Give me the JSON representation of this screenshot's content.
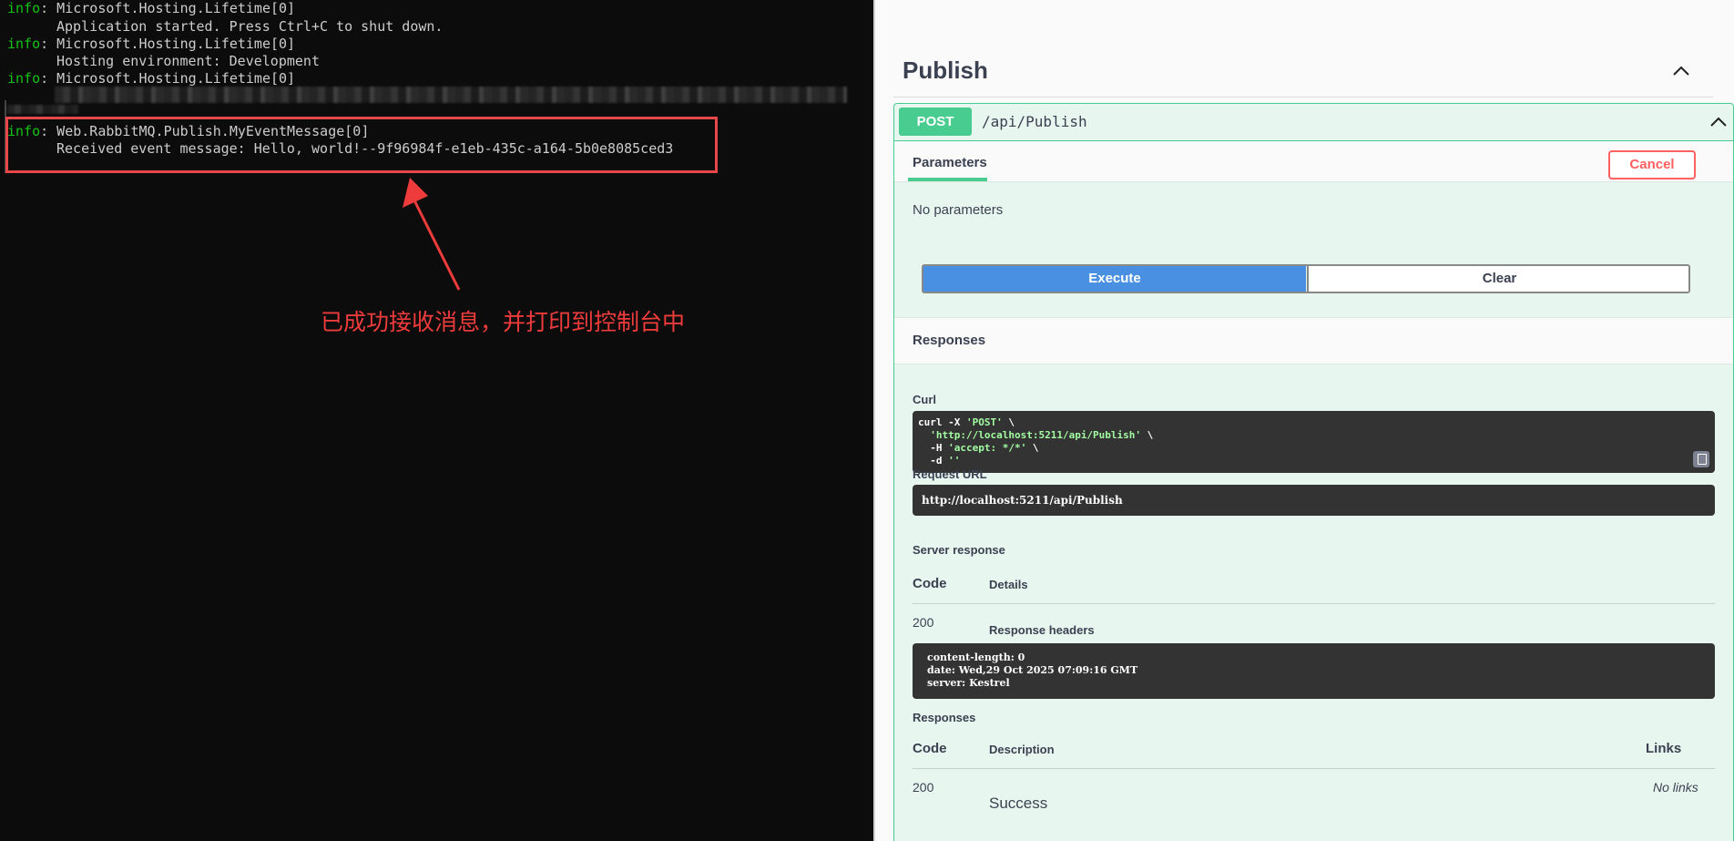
{
  "terminal": {
    "lines": [
      {
        "level": "info",
        "text": ": Microsoft.Hosting.Lifetime[0]"
      },
      {
        "text": "Application started. Press Ctrl+C to shut down."
      },
      {
        "level": "info",
        "text": ": Microsoft.Hosting.Lifetime[0]"
      },
      {
        "text": "Hosting environment: Development"
      },
      {
        "level": "info",
        "text": ": Microsoft.Hosting.Lifetime[0]"
      },
      {
        "level": "info",
        "text": ": Web.RabbitMQ.Publish.MyEventMessage[0]"
      },
      {
        "text": "Received event message: Hello, world!--9f96984f-e1eb-435c-a164-5b0e8085ced3"
      }
    ],
    "annotation": "已成功接收消息，并打印到控制台中",
    "annotation_color": "#ee3b3b"
  },
  "swagger": {
    "tag_title": "Publish",
    "operation": {
      "method": "POST",
      "path": "/api/Publish",
      "method_color": "#49cc90"
    },
    "parameters_tab": "Parameters",
    "cancel_label": "Cancel",
    "no_parameters": "No parameters",
    "execute_label": "Execute",
    "clear_label": "Clear",
    "responses_title": "Responses",
    "curl_label": "Curl",
    "curl": {
      "line1_cmd": "curl -X ",
      "line1_str": "'POST'",
      "line1_tail": " \\",
      "line2_str": "'http://localhost:5211/api/Publish'",
      "line2_tail": " \\",
      "line3_cmd": "-H ",
      "line3_str": "'accept: */*'",
      "line3_tail": " \\",
      "line4_cmd": "-d ",
      "line4_str": "''"
    },
    "request_url_label": "Request URL",
    "request_url": "http://localhost:5211/api/Publish",
    "server_response_label": "Server response",
    "code_header": "Code",
    "details_header": "Details",
    "server_code": "200",
    "response_headers_label": "Response headers",
    "response_headers": [
      "content-length: 0",
      "date: Wed,29 Oct 2025 07:09:16 GMT",
      "server: Kestrel"
    ],
    "responses_label": "Responses",
    "description_header": "Description",
    "links_header": "Links",
    "resp_code": "200",
    "resp_description": "Success",
    "resp_links": "No links"
  }
}
